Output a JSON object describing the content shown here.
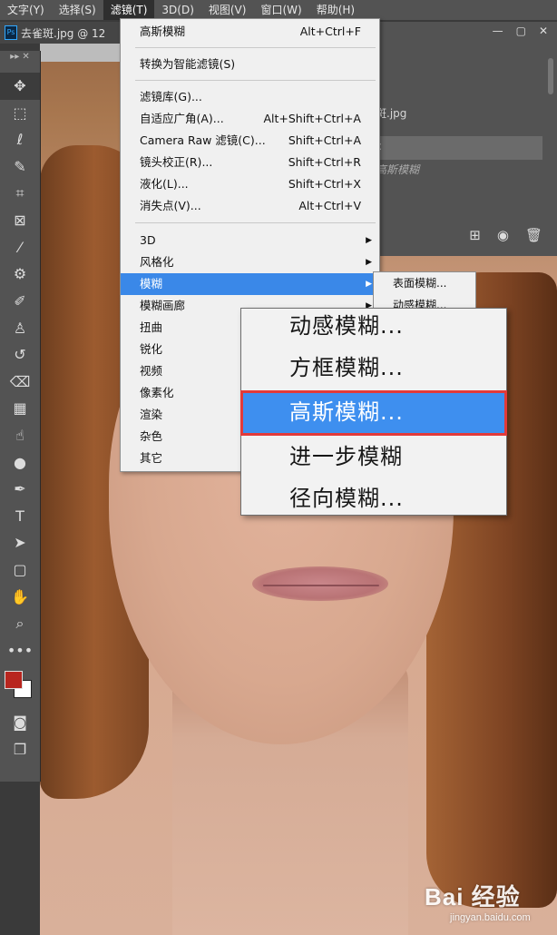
{
  "menubar": {
    "items": [
      "文字(Y)",
      "选择(S)",
      "滤镜(T)",
      "3D(D)",
      "视图(V)",
      "窗口(W)",
      "帮助(H)"
    ],
    "active": "滤镜(T)"
  },
  "document": {
    "tab_title": "去雀斑.jpg @ 12"
  },
  "right_panel": {
    "file_label": "斑.jpg",
    "selected_label": "c",
    "italic_label": "高斯模糊"
  },
  "filter_menu": {
    "last_filter": {
      "label": "高斯模糊",
      "shortcut": "Alt+Ctrl+F"
    },
    "convert_smart": {
      "label": "转换为智能滤镜(S)"
    },
    "gallery": {
      "label": "滤镜库(G)..."
    },
    "adaptive_wide": {
      "label": "自适应广角(A)...",
      "shortcut": "Alt+Shift+Ctrl+A"
    },
    "camera_raw": {
      "label": "Camera Raw 滤镜(C)...",
      "shortcut": "Shift+Ctrl+A"
    },
    "lens_correction": {
      "label": "镜头校正(R)...",
      "shortcut": "Shift+Ctrl+R"
    },
    "liquify": {
      "label": "液化(L)...",
      "shortcut": "Shift+Ctrl+X"
    },
    "vanishing_point": {
      "label": "消失点(V)...",
      "shortcut": "Alt+Ctrl+V"
    },
    "submenus": [
      {
        "label": "3D",
        "has_arrow": true
      },
      {
        "label": "风格化",
        "has_arrow": true
      },
      {
        "label": "模糊",
        "has_arrow": true,
        "highlighted": true
      },
      {
        "label": "模糊画廊",
        "has_arrow": true
      },
      {
        "label": "扭曲"
      },
      {
        "label": "锐化"
      },
      {
        "label": "视频"
      },
      {
        "label": "像素化"
      },
      {
        "label": "渲染"
      },
      {
        "label": "杂色"
      },
      {
        "label": "其它"
      }
    ]
  },
  "blur_submenu_small": [
    "表面模糊...",
    "动感模糊..."
  ],
  "zoom_callout": {
    "items": [
      {
        "label": "动感模糊..."
      },
      {
        "label": "方框模糊..."
      },
      {
        "label": "高斯模糊...",
        "highlighted": true
      },
      {
        "label": "进一步模糊"
      },
      {
        "label": "径向模糊..."
      }
    ],
    "highlight_color": "#3e8fef",
    "outline_color": "#e23a3a"
  },
  "watermark": {
    "logo": "Bai 经验",
    "url": "jingyan.baidu.com"
  },
  "colors": {
    "foreground": "#b8261f",
    "background": "#ffffff",
    "menu_highlight": "#3a88e8"
  },
  "toolbar_icons": [
    "move-icon",
    "marquee-icon",
    "lasso-icon",
    "quick-select-icon",
    "crop-icon",
    "frame-icon",
    "eyedropper-icon",
    "healing-icon",
    "brush-icon",
    "stamp-icon",
    "history-brush-icon",
    "eraser-icon",
    "gradient-icon",
    "smudge-icon",
    "dodge-icon",
    "pen-icon",
    "type-icon",
    "path-select-icon",
    "rectangle-icon",
    "hand-icon",
    "zoom-icon",
    "more-icon"
  ]
}
